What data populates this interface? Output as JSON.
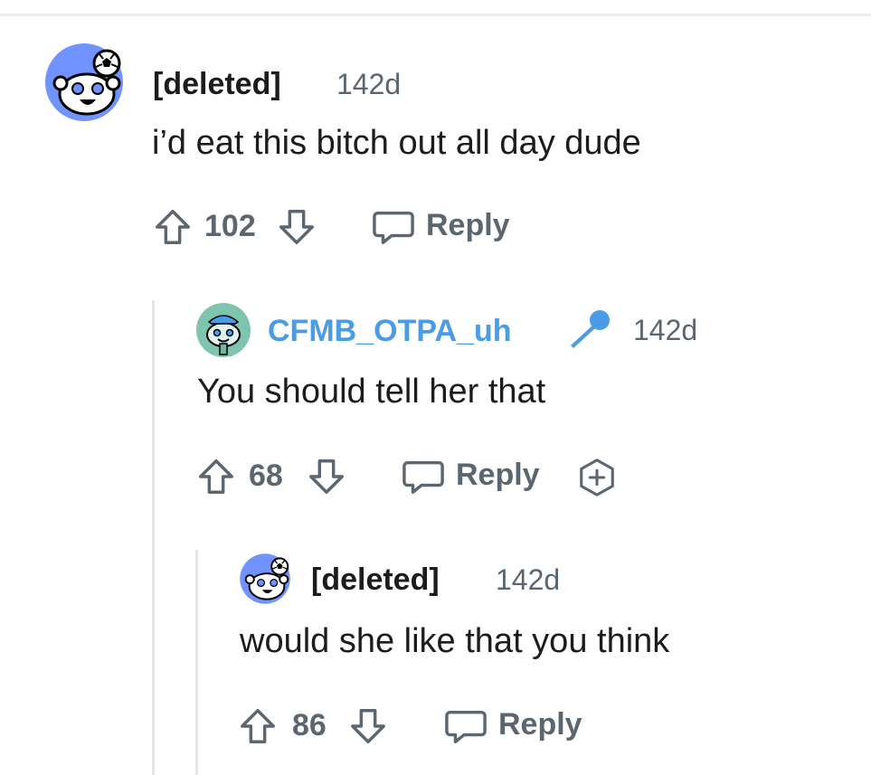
{
  "comments": [
    {
      "username": "[deleted]",
      "time": "142d",
      "body": "i’d eat this bitch out all day dude",
      "votes": "102",
      "reply_label": "Reply"
    },
    {
      "username": "CFMB_OTPA_uh",
      "time": "142d",
      "body": "You should tell her that",
      "votes": "68",
      "reply_label": "Reply",
      "username_color": "#4a9be8"
    },
    {
      "username": "[deleted]",
      "time": "142d",
      "body": "would she like that you think",
      "votes": "86",
      "reply_label": "Reply"
    }
  ],
  "icons": [
    "snoo-avatar-icon",
    "upvote-icon",
    "downvote-icon",
    "comment-icon",
    "microphone-icon",
    "award-icon"
  ],
  "colors": {
    "avatar_bg_deleted": "#7193ff",
    "avatar_bg_user": "#7ec4ae",
    "username_link": "#4a9be8",
    "meta_gray": "#5c6670",
    "thread_line": "#e6e6e6"
  }
}
